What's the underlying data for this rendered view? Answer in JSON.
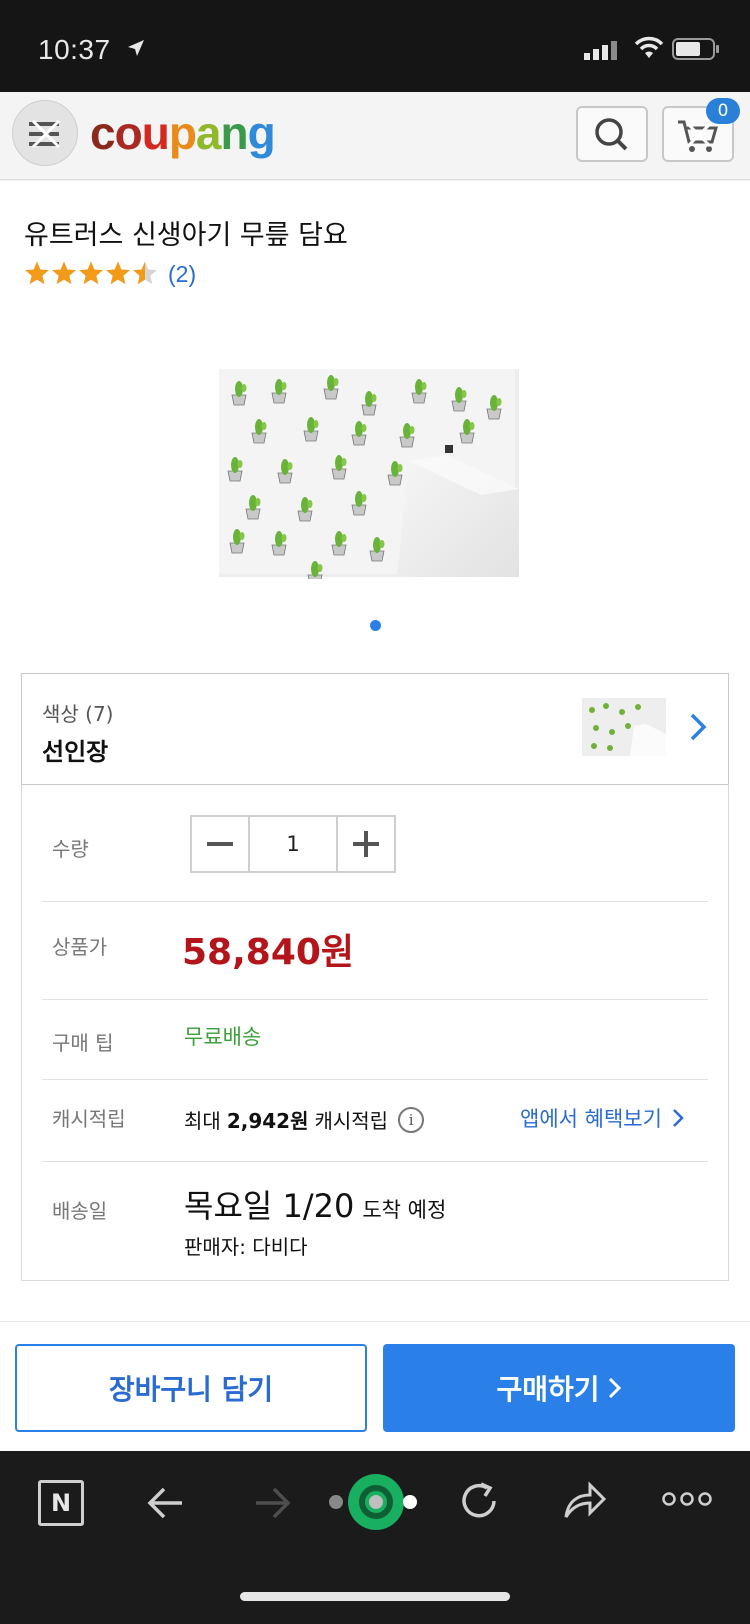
{
  "status_bar": {
    "time": "10:37"
  },
  "header": {
    "logo": [
      "c",
      "o",
      "u",
      "p",
      "a",
      "n",
      "g"
    ],
    "logo_colors": [
      "#8b2a1c",
      "#a82a22",
      "#d3291f",
      "#e98b1a",
      "#8fb82a",
      "#3a9a4a",
      "#2f8ad8"
    ],
    "cart_count": "0"
  },
  "product": {
    "title": "유트러스 신생아기 무릎 담요",
    "rating_stars": 4.5,
    "review_count": "(2)",
    "image_index": 1,
    "image_total": 1
  },
  "option": {
    "label": "색상 (7)",
    "value": "선인장"
  },
  "details": {
    "quantity_label": "수량",
    "quantity_value": "1",
    "price_label": "상품가",
    "price": "58,840원",
    "tip_label": "구매 팁",
    "tip_value": "무료배송",
    "cash_label": "캐시적립",
    "cash_prefix": "최대",
    "cash_amount": "2,942원",
    "cash_suffix": "캐시적립",
    "cash_info": "i",
    "app_link": "앱에서 혜택보기",
    "delivery_label": "배송일",
    "delivery_date": "목요일 1/20",
    "delivery_suffix": "도착 예정",
    "seller": "판매자: 다비다"
  },
  "actions": {
    "cart_button": "장바구니 담기",
    "buy_button": "구매하기"
  },
  "browser": {
    "n_label": "N"
  },
  "colors": {
    "accent_blue": "#2a80e8",
    "price_red": "#b3151b",
    "free_shipping_green": "#3aa03a",
    "star_orange": "#f29b1b"
  }
}
